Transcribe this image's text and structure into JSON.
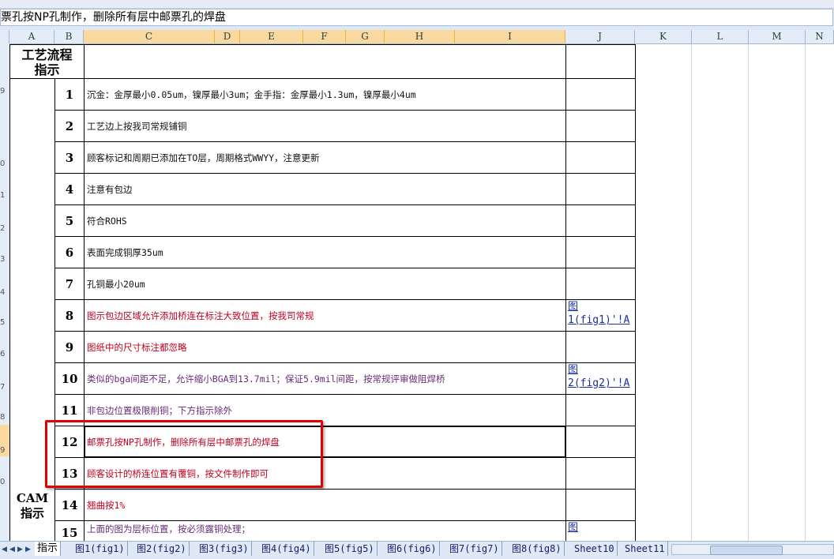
{
  "formula_bar": {
    "content": "票孔按NP孔制作，删除所有层中邮票孔的焊盘"
  },
  "columns": [
    "A",
    "B",
    "C",
    "D",
    "E",
    "F",
    "G",
    "H",
    "I",
    "J",
    "K",
    "L",
    "M",
    "N"
  ],
  "header_left": {
    "line1": "工艺流程",
    "line2": "指示"
  },
  "cam_label": {
    "line1": "CAM",
    "line2": "指示"
  },
  "row_marks": [
    "9",
    "0",
    "1",
    "2",
    "3",
    "4",
    "5",
    "6",
    "7",
    "8",
    "9",
    "0"
  ],
  "rows": [
    {
      "num": "1",
      "text": "沉金：金厚最小0.05um，镍厚最小3um；金手指：金厚最小1.3um，镍厚最小4um",
      "color": "black"
    },
    {
      "num": "2",
      "text": "工艺边上按我司常规铺铜",
      "color": "black"
    },
    {
      "num": "3",
      "text": "顾客标记和周期已添加在TO层，周期格式WWYY，注意更新",
      "color": "black"
    },
    {
      "num": "4",
      "text": "注意有包边",
      "color": "black"
    },
    {
      "num": "5",
      "text": "符合ROHS",
      "color": "black"
    },
    {
      "num": "6",
      "text": "表面完成铜厚35um",
      "color": "black"
    },
    {
      "num": "7",
      "text": "孔铜最小20um",
      "color": "black"
    },
    {
      "num": "8",
      "text": "图示包边区域允许添加桥连在标注大致位置，按我司常规",
      "color": "red"
    },
    {
      "num": "9",
      "text": "图纸中的尺寸标注都忽略",
      "color": "red"
    },
    {
      "num": "10",
      "text": "类似的bga间距不足，允许缩小BGA到13.7mil；保证5.9mil间距，按常规评审做阻焊桥",
      "color": "purple"
    },
    {
      "num": "11",
      "text": "非包边位置极限削铜；下方指示除外",
      "color": "purple"
    },
    {
      "num": "12",
      "text": "邮票孔按NP孔制作，删除所有层中邮票孔的焊盘",
      "color": "red"
    },
    {
      "num": "13",
      "text": "顾客设计的桥连位置有覆铜，按文件制作即可",
      "color": "red"
    },
    {
      "num": "14",
      "text": "翘曲按1%",
      "color": "red"
    },
    {
      "num": "15",
      "text": "上面的图为层标位置，按必须露铜处理；",
      "color": "purple"
    }
  ],
  "links": {
    "row8": {
      "line1": "图",
      "line2": "1(fig1)'!A"
    },
    "row10": {
      "line1": "图",
      "line2": "2(fig2)'!A"
    },
    "row15": {
      "line1": "图",
      "line2": ""
    }
  },
  "sheet_tabs": [
    "指示",
    "图1(fig1)",
    "图2(fig2)",
    "图3(fig3)",
    "图4(fig4)",
    "图5(fig5)",
    "图6(fig6)",
    "图7(fig7)",
    "图8(fig8)",
    "Sheet10",
    "Sheet11"
  ],
  "colors": {
    "header_bg": "#e4ecf7",
    "selected_header": "#f9d99f",
    "highlight": "#e00000",
    "link": "#1a2f9a"
  }
}
